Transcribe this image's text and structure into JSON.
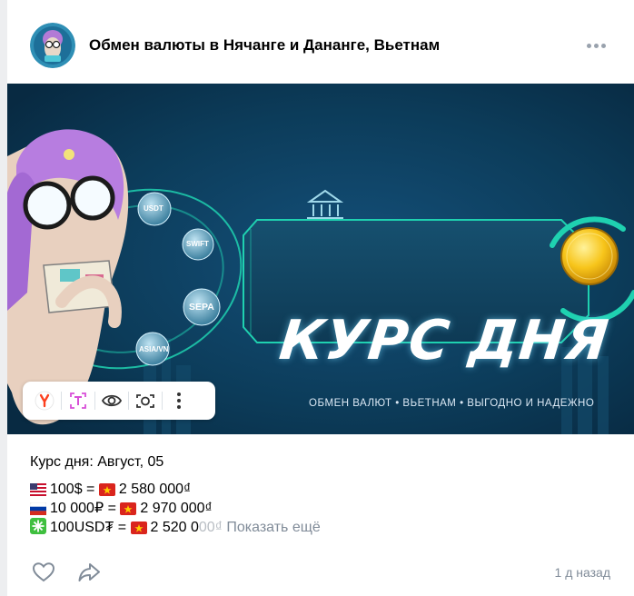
{
  "post": {
    "community_name": "Обмен валюты в Нячанге и Дананге, Вьетнам",
    "banner": {
      "title": "КУРС ДНЯ",
      "subtitle": "ОБМЕН ВАЛЮТ • ВЬЕТНАМ • ВЫГОДНО И НАДЕЖНО",
      "badges": [
        "USDT",
        "SWIFT",
        "SEPA",
        "ASIA/VN"
      ]
    },
    "image_toolbar": {
      "icons": [
        "yandex-search-icon",
        "text-recognition-icon",
        "eye-icon",
        "camera-icon",
        "more-vertical-icon"
      ]
    },
    "text": {
      "heading": "Курс дня: Август, 05",
      "rates": [
        {
          "flag": "us-flag",
          "from": "100$",
          "eq": "=",
          "to_flag": "vn-flag",
          "to": "2 580 000₫"
        },
        {
          "flag": "ru-flag",
          "from": "10 000₽",
          "eq": "=",
          "to_flag": "vn-flag",
          "to": "2 970 000₫"
        },
        {
          "flag": "sparkle-emoji",
          "from": "100USD₮",
          "eq": "=",
          "to_flag": "vn-flag",
          "to_visible": "2 520 0",
          "to_faded": "00₫"
        }
      ],
      "show_more": "Показать ещё"
    },
    "footer": {
      "like_icon": "heart-icon",
      "share_icon": "share-icon",
      "time": "1 д назад"
    },
    "colors": {
      "accent_teal": "#1fd1b0",
      "banner_bg": "#0c3c5a",
      "coin_gold": "#f7c51b",
      "secondary_text": "#818c99"
    }
  }
}
